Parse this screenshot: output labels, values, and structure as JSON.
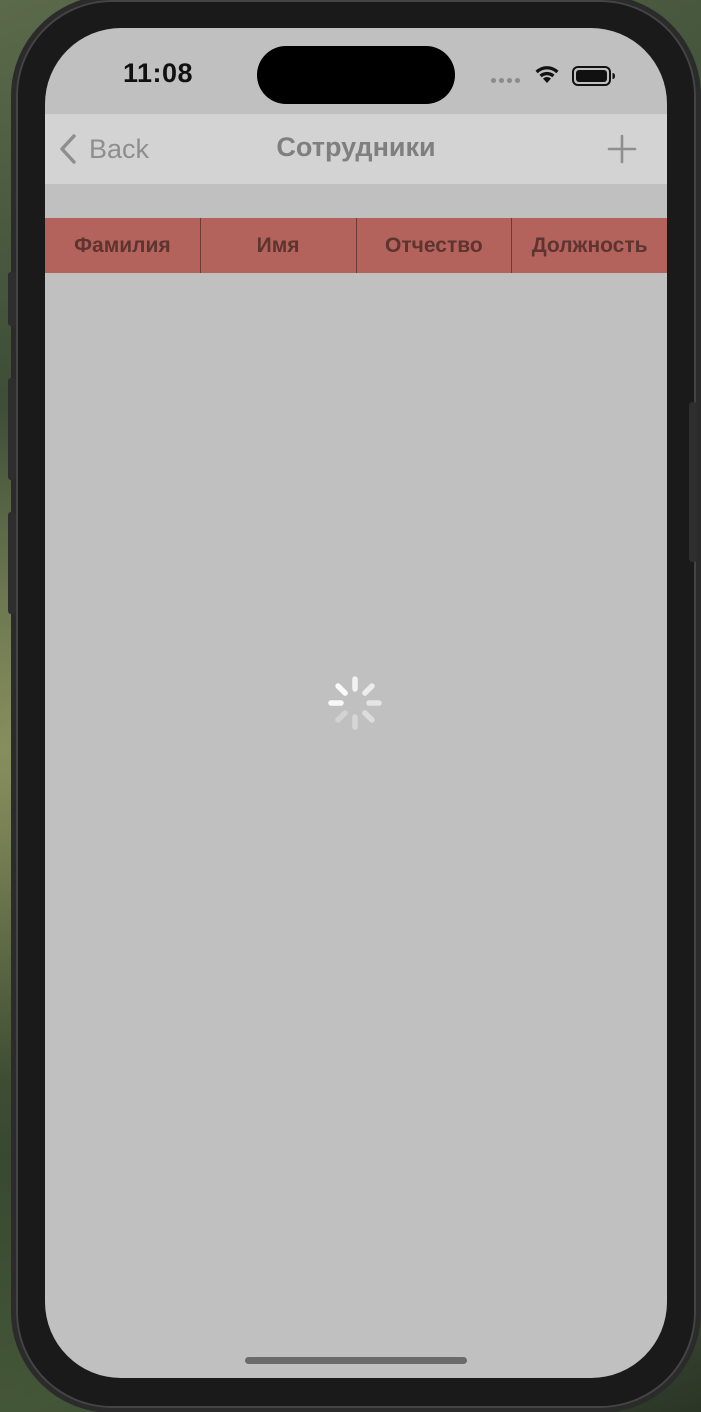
{
  "status_bar": {
    "time": "11:08"
  },
  "navbar": {
    "back_label": "Back",
    "title": "Сотрудники",
    "add_icon": "plus-icon"
  },
  "table": {
    "columns": [
      "Фамилия",
      "Имя",
      "Отчество",
      "Должность"
    ],
    "rows": []
  },
  "loading": true,
  "colors": {
    "screen_bg": "#c0c0c0",
    "navbar_bg": "#d3d3d3",
    "header_bg": "#b3635c",
    "header_text": "#5d3430"
  }
}
